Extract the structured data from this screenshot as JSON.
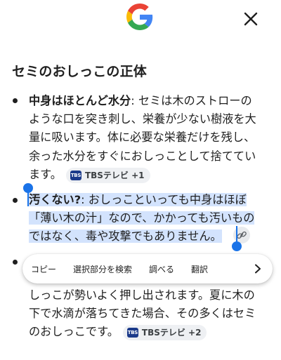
{
  "header": {
    "logo_icon": "google-g-icon",
    "close_icon": "close-icon"
  },
  "article": {
    "heading": "セミのおしっこの正体",
    "items": [
      {
        "lead": "中身はほとんど水分",
        "sep": ": ",
        "lines": [
          "セミは木のストローの",
          "ような口を突き刺し、栄養が少ない樹液を大",
          "量に吸います。体に必要な栄養だけを残し、",
          "余った水分をすぐにおしっことして捨ててい",
          "ます。"
        ],
        "chip": {
          "logo": "TBS",
          "label": "TBSテレビ +1"
        }
      },
      {
        "lead": "汚くない?",
        "sep": ": ",
        "lines": [
          "おしっこといっても中身はほぼ",
          "「薄い木の汁」なので、かかっても汚いもの",
          "ではなく、毒や攻撃でもありません。"
        ],
        "link_icon": "link-icon"
      },
      {
        "lines": [
          "しっこが勢いよく押し出されます。夏に木の",
          "下で水滴が落ちてきた場合、その多くはセミ",
          "のおしっこです。"
        ],
        "chip": {
          "logo": "TBS",
          "label": "TBSテレビ +2"
        }
      }
    ]
  },
  "context_menu": {
    "items": [
      "コピー",
      "選択部分を検索",
      "調べる",
      "翻訳"
    ],
    "more_icon": "chevron-right-icon"
  },
  "colors": {
    "selection": "#d3e3fd",
    "handle": "#1a73e8"
  }
}
